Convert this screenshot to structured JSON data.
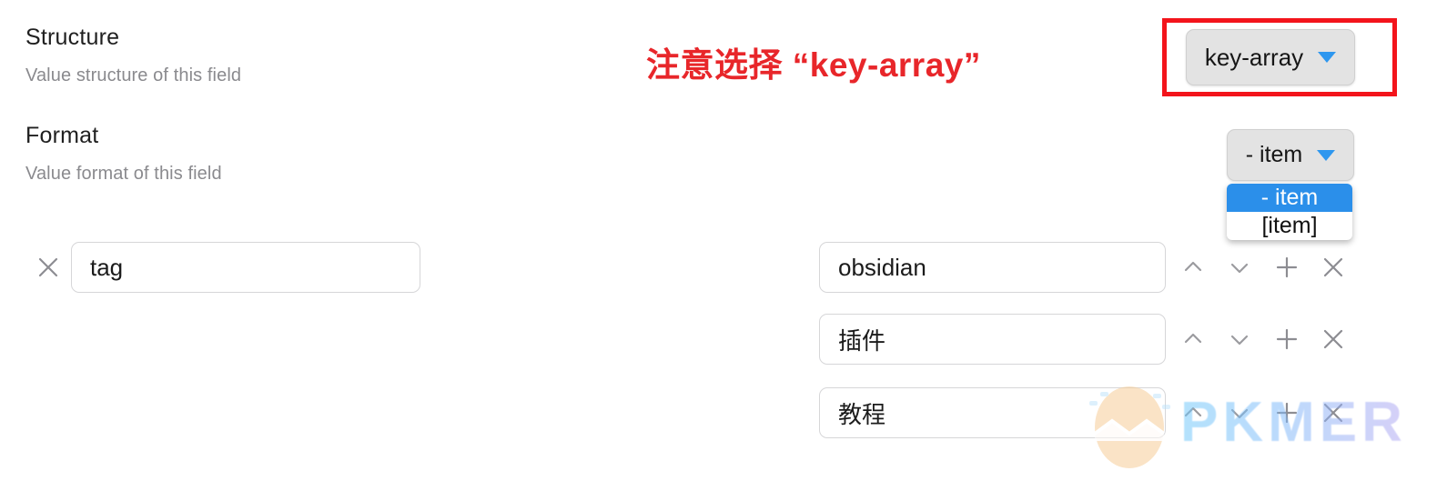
{
  "settings": [
    {
      "title": "Structure",
      "description": "Value structure of this field",
      "control_value": "key-array"
    },
    {
      "title": "Format",
      "description": "Value format of this field",
      "control_value": "- item"
    }
  ],
  "annotation": {
    "text": "注意选择 “key-array”",
    "color": "#e8262a"
  },
  "highlight_box": {
    "color": "#f3141b"
  },
  "format_dropdown": {
    "selected": "- item",
    "options": [
      {
        "label": "- item",
        "selected": true
      },
      {
        "label": "[item]",
        "selected": false
      }
    ],
    "highlight_color": "#2b8fea"
  },
  "field_row": {
    "key": {
      "value": "tag",
      "placeholder": "",
      "remove_icon": "close-icon"
    },
    "values": [
      {
        "value": "obsidian",
        "placeholder": ""
      },
      {
        "value": "插件",
        "placeholder": ""
      },
      {
        "value": "教程",
        "placeholder": ""
      }
    ],
    "row_actions": [
      {
        "icon": "chevron-up-icon"
      },
      {
        "icon": "chevron-down-icon"
      },
      {
        "icon": "plus-icon"
      },
      {
        "icon": "close-icon"
      }
    ]
  },
  "watermark": {
    "text": "PKMER",
    "logo": "egg-icon"
  }
}
